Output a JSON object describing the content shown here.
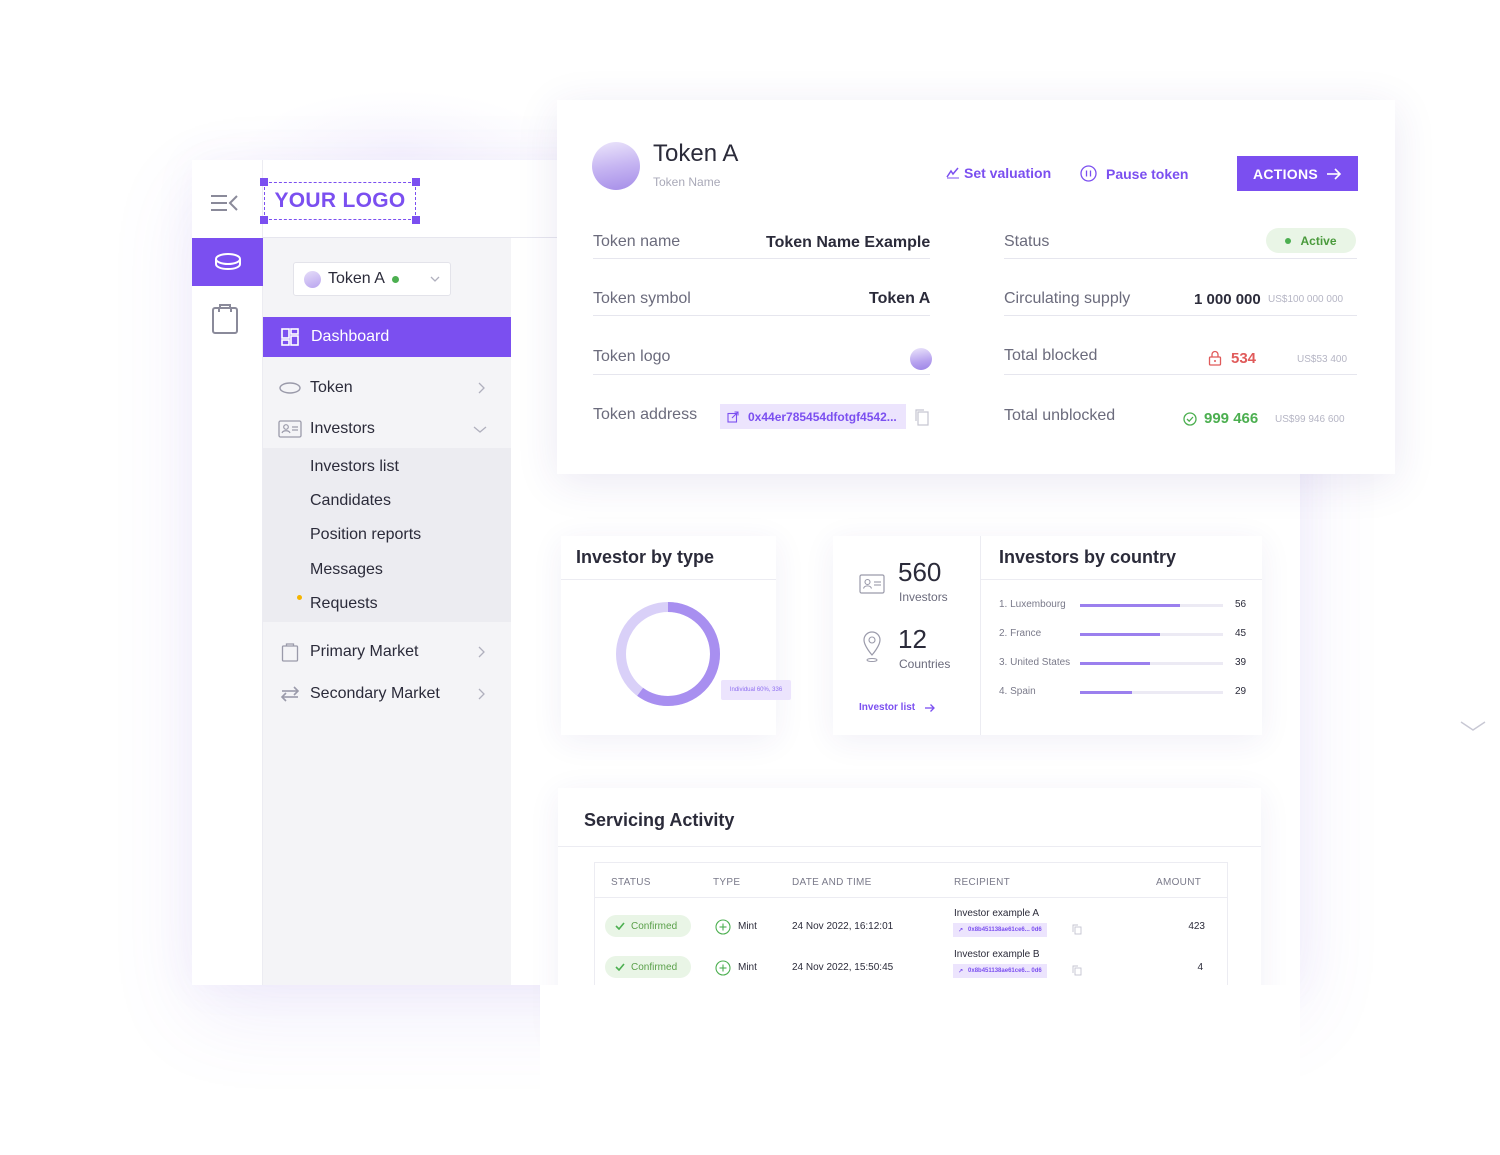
{
  "logo": {
    "text": "YOUR LOGO"
  },
  "sidebar": {
    "token_select": {
      "label": "Token A"
    },
    "dashboard": "Dashboard",
    "items": [
      {
        "label": "Token"
      },
      {
        "label": "Investors"
      },
      {
        "label": "Primary Market"
      },
      {
        "label": "Secondary Market"
      }
    ],
    "investor_subitems": [
      "Investors list",
      "Candidates",
      "Position reports",
      "Messages",
      "Requests"
    ]
  },
  "token": {
    "title": "Token A",
    "subtitle": "Token Name",
    "set_valuation": "Set valuation",
    "pause_token": "Pause token",
    "actions": "ACTIONS",
    "fields": {
      "token_name_label": "Token name",
      "token_name_value": "Token Name Example",
      "token_symbol_label": "Token symbol",
      "token_symbol_value": "Token A",
      "token_logo_label": "Token logo",
      "token_address_label": "Token address",
      "token_address_value": "0x44er785454dfotgf4542...",
      "status_label": "Status",
      "status_value": "Active",
      "circ_label": "Circulating supply",
      "circ_value": "1 000 000",
      "circ_usd": "US$100 000 000",
      "blocked_label": "Total blocked",
      "blocked_value": "534",
      "blocked_usd": "US$53 400",
      "unblocked_label": "Total unblocked",
      "unblocked_value": "999 466",
      "unblocked_usd": "US$99 946 600"
    }
  },
  "investor_type": {
    "title": "Investor by type",
    "tooltip": "Individual 60%, 336",
    "individual_fraction": 0.6
  },
  "stats": {
    "investors_count": "560",
    "investors_label": "Investors",
    "countries_count": "12",
    "countries_label": "Countries",
    "link": "Investor list"
  },
  "countries": {
    "title": "Investors by country",
    "max": 80,
    "rows": [
      {
        "name": "1. Luxembourg",
        "value": 56
      },
      {
        "name": "2. France",
        "value": 45
      },
      {
        "name": "3. United States",
        "value": 39
      },
      {
        "name": "4. Spain",
        "value": 29
      }
    ]
  },
  "servicing": {
    "title": "Servicing Activity",
    "headers": [
      "STATUS",
      "TYPE",
      "DATE AND TIME",
      "RECIPIENT",
      "AMOUNT"
    ],
    "rows": [
      {
        "status": "Confirmed",
        "type": "Mint",
        "datetime": "24 Nov 2022, 16:12:01",
        "recipient": "Investor example A",
        "hash": "0x8b451138ae61ce6... 0d6",
        "amount": "423"
      },
      {
        "status": "Confirmed",
        "type": "Mint",
        "datetime": "24 Nov 2022, 15:50:45",
        "recipient": "Investor example B",
        "hash": "0x8b451138ae61ce6... 0d6",
        "amount": "4"
      }
    ]
  },
  "colors": {
    "accent": "#7b4ff0",
    "success": "#4caf50",
    "danger": "#e05a5a"
  }
}
